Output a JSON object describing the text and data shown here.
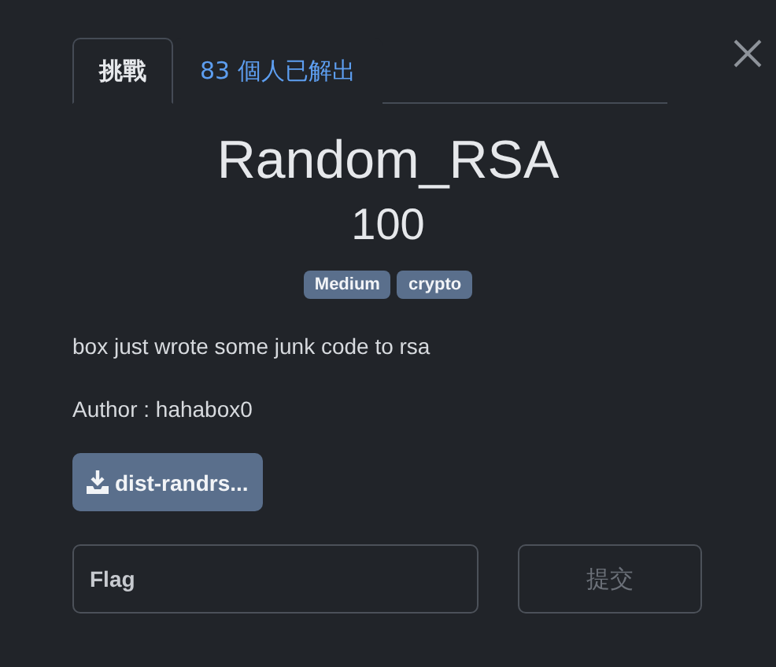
{
  "tabs": [
    {
      "label": "挑戰",
      "selected": true
    },
    {
      "label": "83 個人已解出",
      "selected": false
    }
  ],
  "challenge": {
    "title": "Random_RSA",
    "points": "100",
    "tags": [
      "Medium",
      "crypto"
    ],
    "description": "box just wrote some junk code to rsa",
    "author": "Author : hahabox0"
  },
  "files": [
    "dist-randrs..."
  ],
  "flag_field": {
    "placeholder": "Flag"
  },
  "submit_button": {
    "label": "提交",
    "disabled": true
  }
}
